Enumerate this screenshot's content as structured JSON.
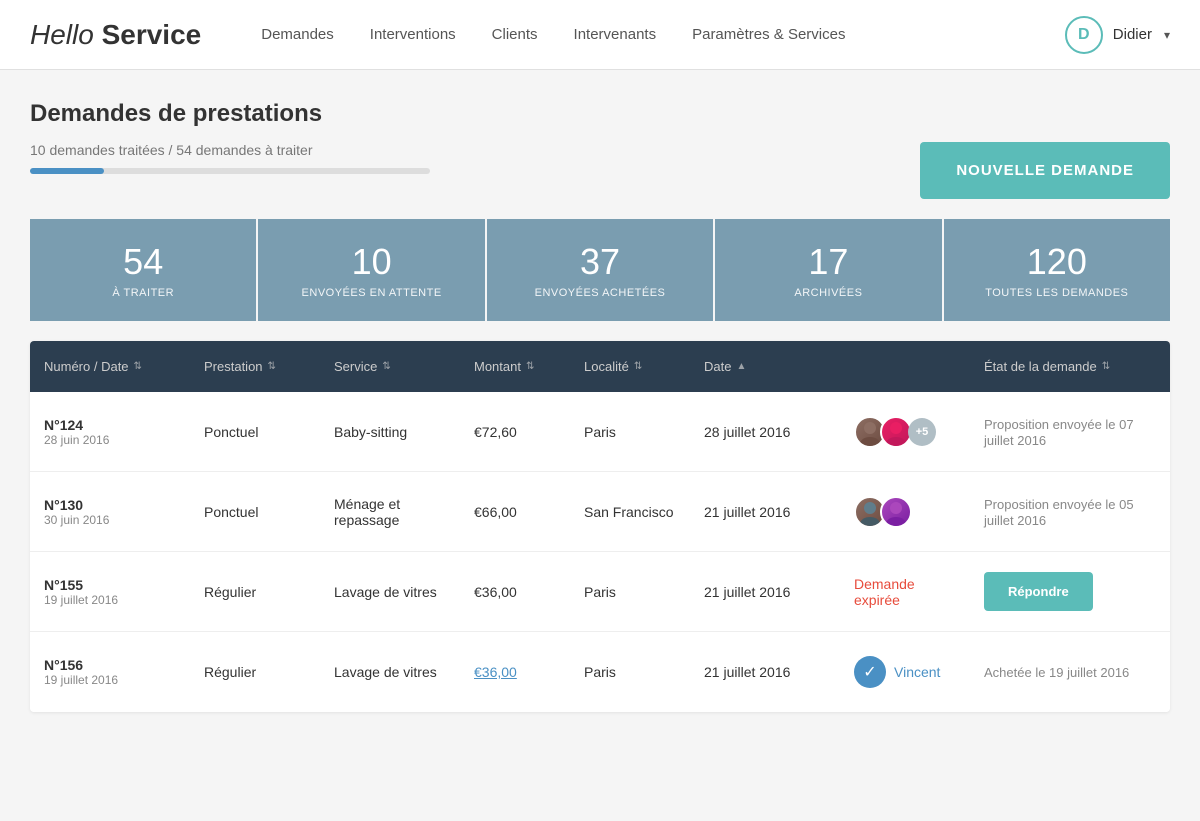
{
  "app": {
    "logo_hello": "Hello",
    "logo_service": "Service"
  },
  "nav": {
    "items": [
      {
        "label": "Demandes"
      },
      {
        "label": "Interventions"
      },
      {
        "label": "Clients"
      },
      {
        "label": "Intervenants"
      },
      {
        "label": "Paramètres & Services"
      }
    ]
  },
  "user": {
    "initial": "D",
    "name": "Didier",
    "chevron": "▾"
  },
  "page": {
    "title": "Demandes de prestations",
    "subtitle": "10 demandes traitées / 54 demandes à traiter",
    "progress_pct": 18.5,
    "new_demand_label": "NOUVELLE DEMANDE"
  },
  "stat_cards": [
    {
      "number": "54",
      "label": "À TRAITER"
    },
    {
      "number": "10",
      "label": "ENVOYÉES EN ATTENTE"
    },
    {
      "number": "37",
      "label": "ENVOYÉES ACHETÉES"
    },
    {
      "number": "17",
      "label": "ARCHIVÉES"
    },
    {
      "number": "120",
      "label": "TOUTES LES DEMANDES"
    }
  ],
  "table": {
    "headers": [
      {
        "label": "Numéro / Date",
        "sort": "⇅"
      },
      {
        "label": "Prestation",
        "sort": "⇅"
      },
      {
        "label": "Service",
        "sort": "⇅"
      },
      {
        "label": "Montant",
        "sort": "⇅"
      },
      {
        "label": "Localité",
        "sort": "⇅"
      },
      {
        "label": "Date",
        "sort": "▲"
      },
      {
        "label": "État de la demande",
        "sort": "⇅"
      }
    ],
    "rows": [
      {
        "num": "N°124",
        "date": "28 juin 2016",
        "prestation": "Ponctuel",
        "service": "Baby-sitting",
        "montant": "€72,60",
        "montant_link": false,
        "localite": "Paris",
        "col_date": "28 juillet 2016",
        "intervenants": "avatars_plus5",
        "etat_type": "text",
        "etat": "Proposition envoyée le 07 juillet 2016",
        "etat_color": "normal"
      },
      {
        "num": "N°130",
        "date": "30 juin 2016",
        "prestation": "Ponctuel",
        "service": "Ménage et repassage",
        "montant": "€66,00",
        "montant_link": false,
        "localite": "San Francisco",
        "col_date": "21 juillet 2016",
        "intervenants": "avatars_2",
        "etat_type": "text",
        "etat": "Proposition envoyée le 05 juillet 2016",
        "etat_color": "normal"
      },
      {
        "num": "N°155",
        "date": "19 juillet 2016",
        "prestation": "Régulier",
        "service": "Lavage de vitres",
        "montant": "€36,00",
        "montant_link": false,
        "localite": "Paris",
        "col_date": "21 juillet 2016",
        "intervenants": "none",
        "etat_type": "expired_btn",
        "etat": "Demande expirée",
        "btn_label": "Répondre",
        "etat_color": "expired"
      },
      {
        "num": "N°156",
        "date": "19 juillet 2016",
        "prestation": "Régulier",
        "service": "Lavage de vitres",
        "montant": "€36,00",
        "montant_link": true,
        "localite": "Paris",
        "col_date": "21 juillet 2016",
        "intervenants": "check_vincent",
        "intervenant_name": "Vincent",
        "etat_type": "bought",
        "etat": "Achetée le 19 juillet 2016",
        "etat_color": "normal"
      }
    ]
  }
}
